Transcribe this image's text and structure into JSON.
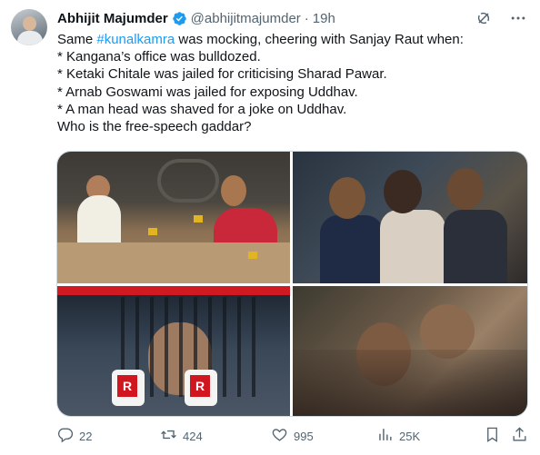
{
  "author": {
    "name": "Abhijit Majumder",
    "handle": "@abhijitmajumder",
    "separator": "·",
    "time": "19h"
  },
  "tweet": {
    "line1_prefix": "Same ",
    "hashtag": "#kunalkamra",
    "line1_suffix": " was mocking, cheering with Sanjay Raut when:",
    "lines": [
      "* Kangana’s office was bulldozed.",
      "* Ketaki Chitale was jailed for criticising Sharad Pawar.",
      "* Arnab Goswami was jailed for exposing Uddhav.",
      "* A man head was shaved for a joke on Uddhav.",
      "Who is the free-speech gaddar?"
    ]
  },
  "media": {
    "mic_letter": "R"
  },
  "actions": {
    "replies": "22",
    "reposts": "424",
    "likes": "995",
    "views": "25K"
  },
  "icons": {
    "verified": "verified-badge-icon",
    "grok": "grok-icon",
    "more": "more-icon",
    "reply": "reply-icon",
    "repost": "repost-icon",
    "like": "heart-icon",
    "views": "views-icon",
    "bookmark": "bookmark-icon",
    "share": "share-icon"
  },
  "colors": {
    "accent": "#1d9bf0",
    "text": "#0f1419",
    "secondary": "#536471"
  }
}
